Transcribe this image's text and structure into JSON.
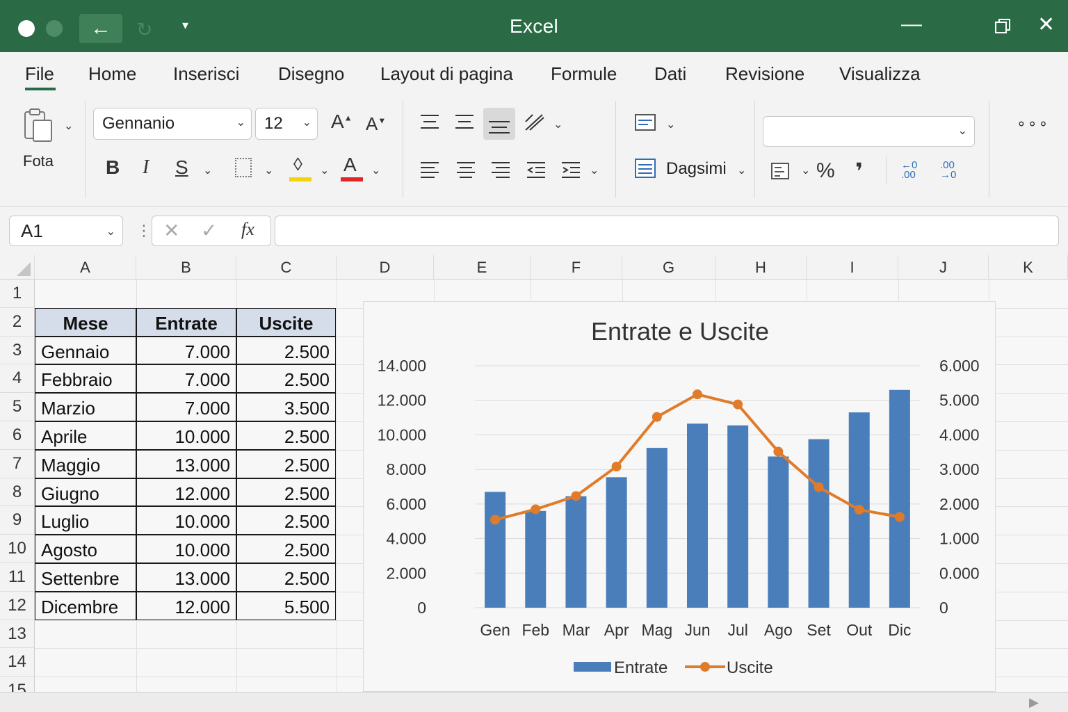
{
  "window": {
    "title": "Excel"
  },
  "tabs": [
    "File",
    "Home",
    "Inserisci",
    "Disegno",
    "Layout di pagina",
    "Formule",
    "Dati",
    "Revisione",
    "Visualizza"
  ],
  "ribbon": {
    "paste_label": "Fota",
    "font_name": "Gennanio",
    "font_size": "12",
    "style_label": "Dagsimi",
    "bold": "B",
    "italic": "I",
    "underline": "S",
    "percent": "%",
    "comma": "❜",
    "dec_increase": "←0 .00",
    "dec_decrease": ".00 →0",
    "more": "∘∘∘",
    "font_color": "#e02626",
    "highlight_color": "#f5d20a"
  },
  "formula_bar": {
    "name_box": "A1",
    "fx": "fx",
    "formula": ""
  },
  "columns": [
    "A",
    "B",
    "C",
    "D",
    "E",
    "F",
    "G",
    "H",
    "I",
    "J",
    "K"
  ],
  "rows": [
    "1",
    "2",
    "3",
    "4",
    "5",
    "6",
    "7",
    "8",
    "9",
    "10",
    "11",
    "12",
    "13",
    "14",
    "15"
  ],
  "table": {
    "headers": [
      "Mese",
      "Entrate",
      "Uscite"
    ],
    "rows": [
      [
        "Gennaio",
        "7.000",
        "2.500"
      ],
      [
        "Febbraio",
        "7.000",
        "2.500"
      ],
      [
        "Marzio",
        "7.000",
        "3.500"
      ],
      [
        "Aprile",
        "10.000",
        "2.500"
      ],
      [
        "Maggio",
        "13.000",
        "2.500"
      ],
      [
        "Giugno",
        "12.000",
        "2.500"
      ],
      [
        "Luglio",
        "10.000",
        "2.500"
      ],
      [
        "Agosto",
        "10.000",
        "2.500"
      ],
      [
        "Settenbre",
        "13.000",
        "2.500"
      ],
      [
        "Dicembre",
        "12.000",
        "5.500"
      ]
    ]
  },
  "chart_data": {
    "type": "bar",
    "title": "Entrate e Uscite",
    "categories": [
      "Gen",
      "Feb",
      "Mar",
      "Apr",
      "Mag",
      "Jun",
      "Jul",
      "Ago",
      "Set",
      "Out",
      "Dic"
    ],
    "series": [
      {
        "name": "Entrate",
        "type": "bar",
        "axis": "left",
        "color": "#4a7ebb",
        "values": [
          6700,
          5600,
          6450,
          7550,
          9250,
          10650,
          10550,
          8750,
          9750,
          11300,
          12600
        ]
      },
      {
        "name": "Uscite",
        "type": "line",
        "axis": "right",
        "color": "#e07b2a",
        "values": [
          2180,
          2440,
          2770,
          3500,
          4730,
          5290,
          5040,
          3870,
          2990,
          2430,
          2250
        ]
      }
    ],
    "y_left": {
      "ylim": [
        0,
        14000
      ],
      "ticks": [
        "0",
        "2.000",
        "4.000",
        "6.000",
        "8.000",
        "10.000",
        "12.000",
        "14.000"
      ]
    },
    "y_right": {
      "ylim": [
        0,
        6000
      ],
      "ticks": [
        "0",
        "0.000",
        "1.000",
        "2.000",
        "3.000",
        "4.000",
        "5.000",
        "6.000"
      ]
    },
    "legend": "bottom",
    "grid": true
  }
}
